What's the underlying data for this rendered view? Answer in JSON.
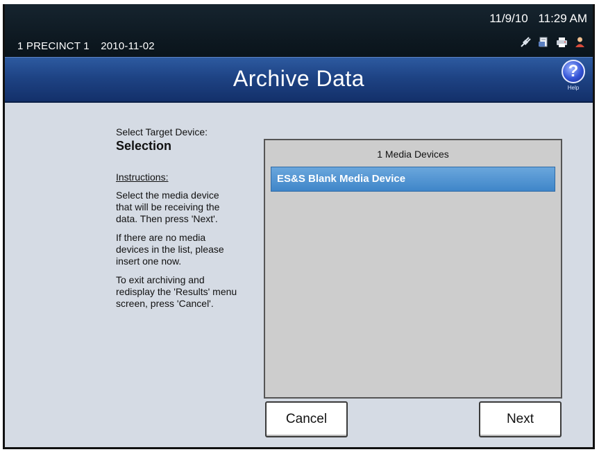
{
  "status": {
    "precinct": "1 PRECINCT 1",
    "date": "2010-11-02",
    "clock_date": "11/9/10",
    "clock_time": "11:29 AM",
    "icons": [
      "power-plug-icon",
      "document-icon",
      "printer-icon",
      "user-icon"
    ]
  },
  "header": {
    "title": "Archive Data",
    "help_symbol": "?",
    "help_label": "Help"
  },
  "instructions": {
    "select_label": "Select Target Device:",
    "heading": "Selection",
    "instructions_label": "Instructions:",
    "paragraphs": [
      "Select the media device that will be receiving the data. Then press 'Next'.",
      "If there are no media devices in the list, please insert one now.",
      "To exit archiving and redisplay the 'Results' menu screen, press 'Cancel'."
    ]
  },
  "device_list": {
    "header": "1 Media Devices",
    "items": [
      "ES&S Blank Media Device"
    ],
    "selected_index": 0
  },
  "buttons": {
    "cancel": "Cancel",
    "next": "Next"
  },
  "colors": {
    "title_bar": "#1e4384",
    "status_bar": "#0d1820",
    "background": "#d5dbe4",
    "selected_item": "#3f86c9"
  }
}
